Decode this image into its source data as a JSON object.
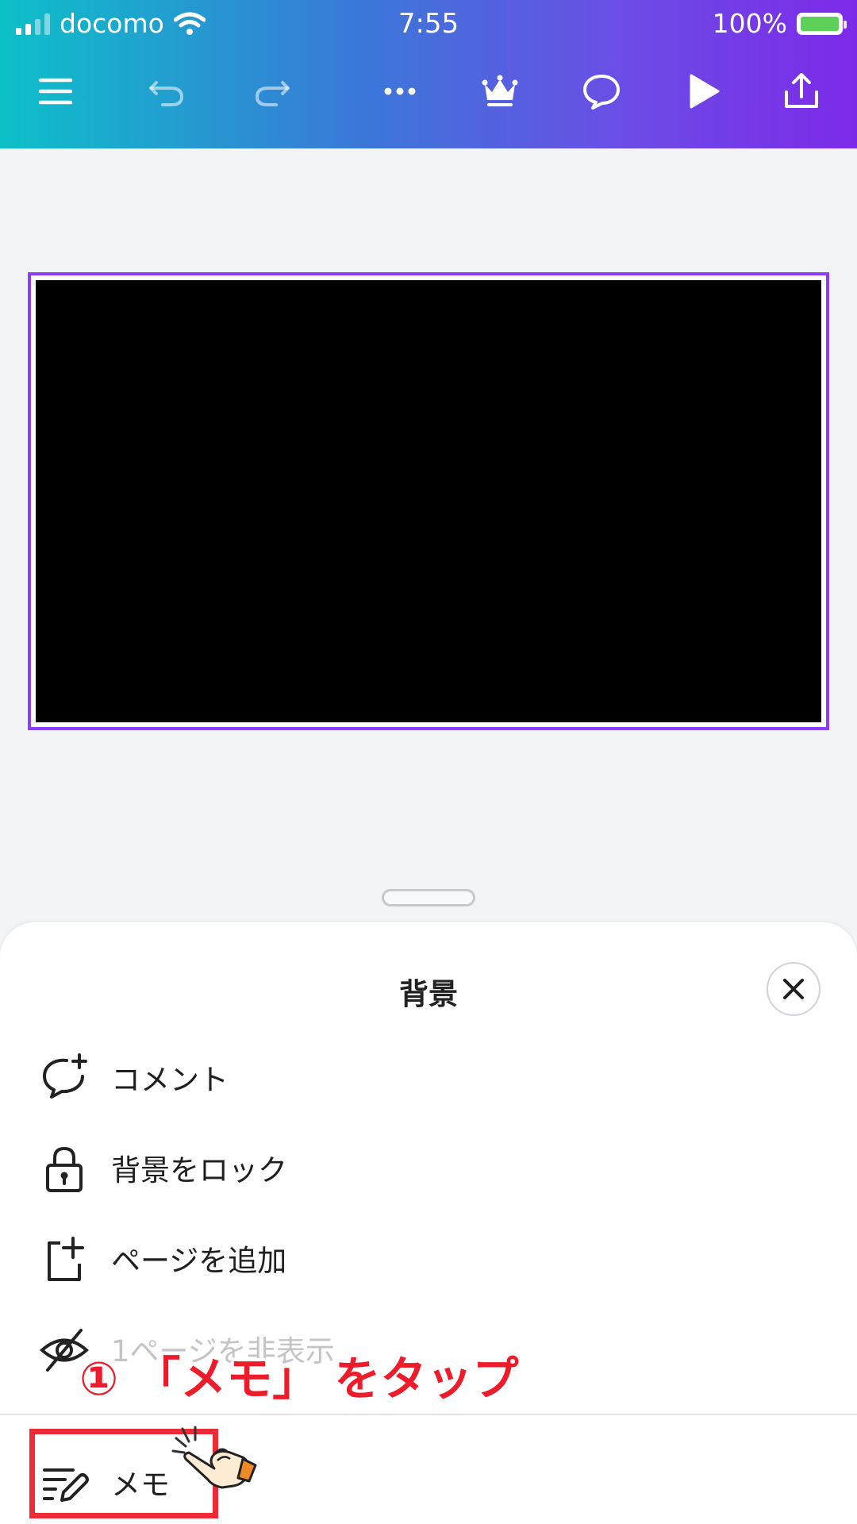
{
  "status_bar": {
    "carrier": "docomo",
    "time": "7:55",
    "battery_percent": "100%",
    "battery_level": 1.0,
    "signal_bars_filled": 2,
    "signal_bars_total": 4
  },
  "toolbar": {
    "icons": [
      "menu-icon",
      "undo-icon",
      "redo-icon",
      "more-icon",
      "crown-icon",
      "comment-icon",
      "play-icon",
      "share-icon"
    ]
  },
  "colors": {
    "header_gradient": [
      "#0cc0c8",
      "#3a78d8",
      "#6a4ee6",
      "#7d2ae8"
    ],
    "selection": "#8b3dff",
    "annotation_red": "#ee1c2a"
  },
  "sheet": {
    "title": "背景",
    "items": [
      {
        "label": "コメント",
        "icon": "comment-add-icon"
      },
      {
        "label": "背景をロック",
        "icon": "lock-icon"
      },
      {
        "label": "ページを追加",
        "icon": "add-page-icon"
      },
      {
        "label": "1ページを非表示",
        "icon": "eye-off-icon"
      },
      {
        "label": "メモ",
        "icon": "notes-icon"
      }
    ]
  },
  "annotation": {
    "text": "① 「メモ」 をタップ"
  }
}
